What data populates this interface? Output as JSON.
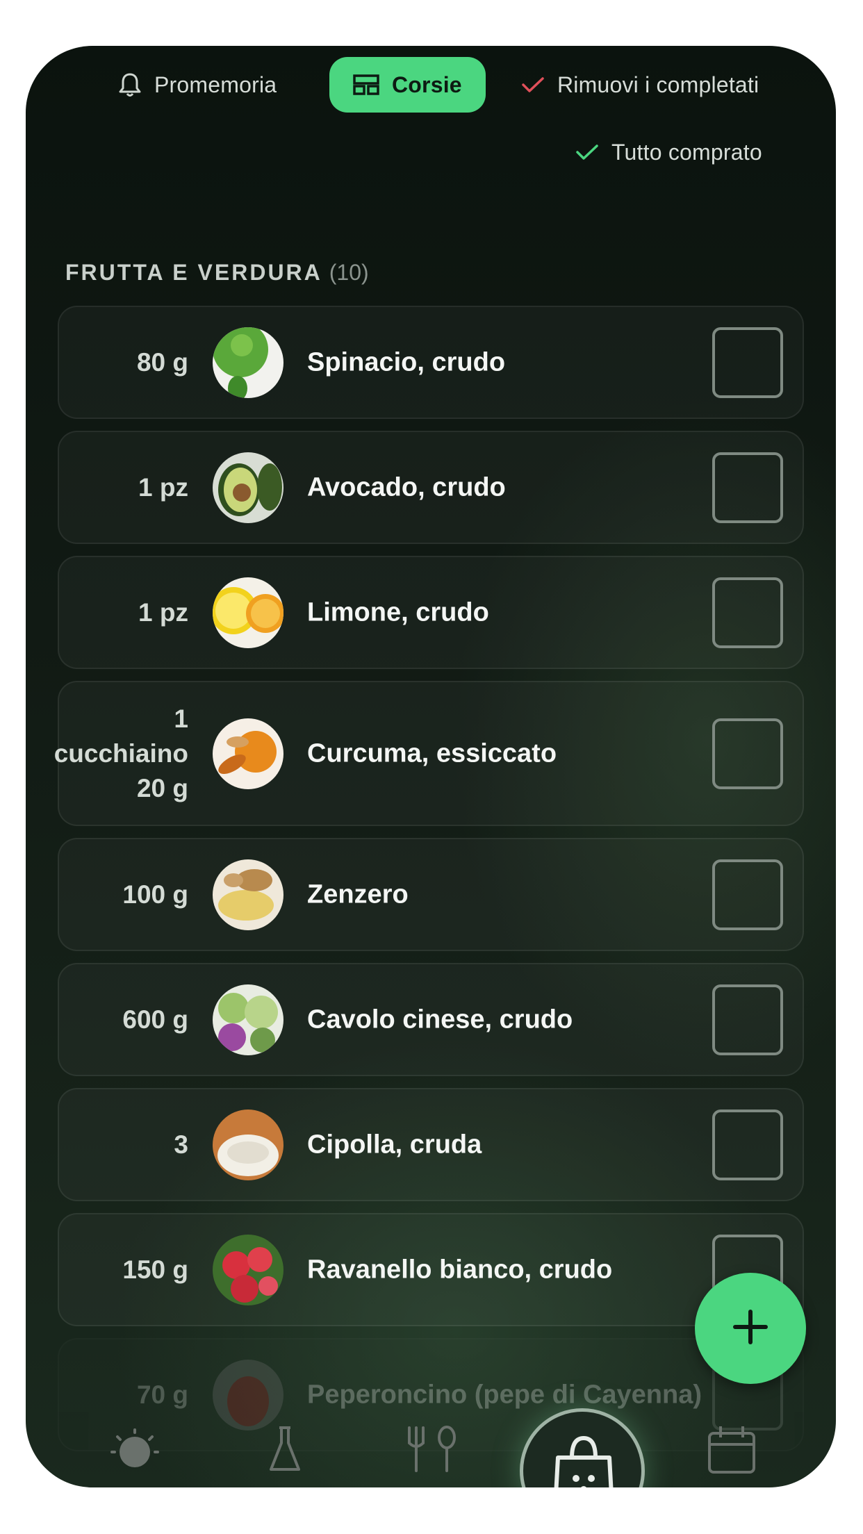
{
  "toolbar": {
    "reminder_label": "Promemoria",
    "aisles_label": "Corsie",
    "remove_completed_label": "Rimuovi i completati",
    "all_bought_label": "Tutto comprato"
  },
  "section": {
    "title": "FRUTTA E VERDURA",
    "count": "(10)"
  },
  "items": [
    {
      "qty": "80 g",
      "name": "Spinacio, crudo",
      "image": "spinach-juice"
    },
    {
      "qty": "1 pz",
      "name": "Avocado, crudo",
      "image": "avocado"
    },
    {
      "qty": "1 pz",
      "name": "Limone, crudo",
      "image": "lemon"
    },
    {
      "qty": "1\ncucchiaino\n20 g",
      "name": "Curcuma, essiccato",
      "image": "turmeric"
    },
    {
      "qty": "100 g",
      "name": "Zenzero",
      "image": "ginger"
    },
    {
      "qty": "600 g",
      "name": "Cavolo cinese, crudo",
      "image": "chinese-cabbage"
    },
    {
      "qty": "3",
      "name": "Cipolla, cruda",
      "image": "onion"
    },
    {
      "qty": "150 g",
      "name": "Ravanello bianco, crudo",
      "image": "radish"
    },
    {
      "qty": "70 g",
      "name": "Peperoncino (pepe di Cayenna)",
      "image": "chili"
    }
  ],
  "fab": {
    "icon": "plus-icon"
  },
  "bottom_nav": [
    {
      "icon": "sun-icon"
    },
    {
      "icon": "flask-icon"
    },
    {
      "icon": "cutlery-icon"
    },
    {
      "icon": "shopping-bag-icon",
      "active": true
    },
    {
      "icon": "calendar-icon"
    }
  ],
  "colors": {
    "accent": "#4bd680",
    "background": "#111a14",
    "remove_check": "#e0505a",
    "done_check": "#4bd680"
  }
}
